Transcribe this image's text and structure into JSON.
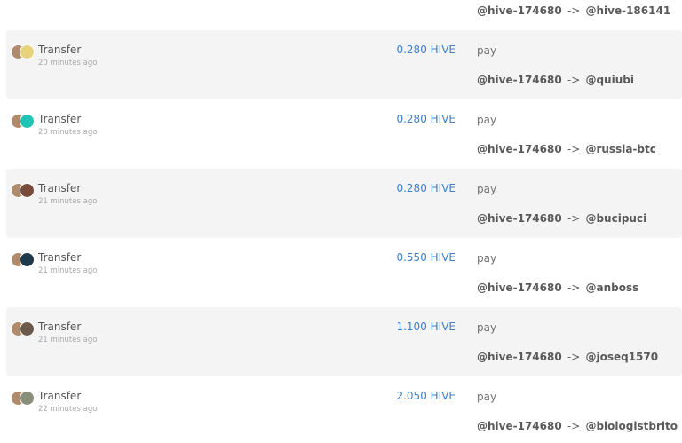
{
  "top": {
    "from": "@hive-174680",
    "arrow": "->",
    "to": "@hive-186141"
  },
  "ops": [
    {
      "type": "Transfer",
      "time": "20 minutes ago",
      "amount": "0.280 HIVE",
      "memo": "pay",
      "from": "@hive-174680",
      "arrow": "->",
      "to": "@quiubi",
      "shaded": true,
      "avatar_colors": [
        "#b08a6a",
        "#e8d27a"
      ]
    },
    {
      "type": "Transfer",
      "time": "20 minutes ago",
      "amount": "0.280 HIVE",
      "memo": "pay",
      "from": "@hive-174680",
      "arrow": "->",
      "to": "@russia-btc",
      "shaded": false,
      "avatar_colors": [
        "#b08a6a",
        "#1fc4b4"
      ]
    },
    {
      "type": "Transfer",
      "time": "21 minutes ago",
      "amount": "0.280 HIVE",
      "memo": "pay",
      "from": "@hive-174680",
      "arrow": "->",
      "to": "@bucipuci",
      "shaded": true,
      "avatar_colors": [
        "#b08a6a",
        "#7a4b3a"
      ]
    },
    {
      "type": "Transfer",
      "time": "21 minutes ago",
      "amount": "0.550 HIVE",
      "memo": "pay",
      "from": "@hive-174680",
      "arrow": "->",
      "to": "@anboss",
      "shaded": false,
      "avatar_colors": [
        "#b08a6a",
        "#1e3a4a"
      ]
    },
    {
      "type": "Transfer",
      "time": "21 minutes ago",
      "amount": "1.100 HIVE",
      "memo": "pay",
      "from": "@hive-174680",
      "arrow": "->",
      "to": "@joseq1570",
      "shaded": true,
      "avatar_colors": [
        "#b08a6a",
        "#6b5a4a"
      ]
    },
    {
      "type": "Transfer",
      "time": "22 minutes ago",
      "amount": "2.050 HIVE",
      "memo": "pay",
      "from": "@hive-174680",
      "arrow": "->",
      "to": "@biologistbrito",
      "shaded": false,
      "avatar_colors": [
        "#b08a6a",
        "#8a8f7a"
      ]
    }
  ]
}
